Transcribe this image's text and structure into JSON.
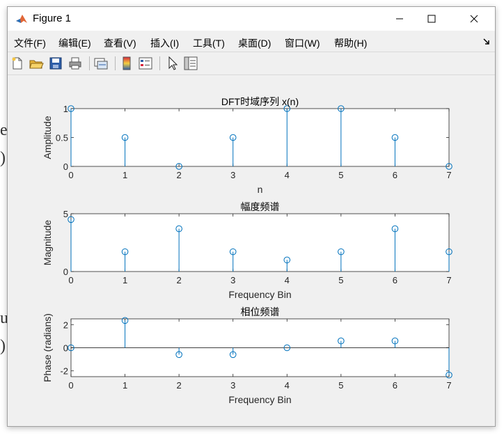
{
  "window": {
    "title": "Figure 1"
  },
  "menubar": {
    "items": [
      "文件(F)",
      "编辑(E)",
      "查看(V)",
      "插入(I)",
      "工具(T)",
      "桌面(D)",
      "窗口(W)",
      "帮助(H)"
    ]
  },
  "toolbar": {
    "buttons": [
      "new-figure-icon",
      "open-file-icon",
      "save-icon",
      "print-icon",
      "link-plot-icon",
      "colorbar-icon",
      "legend-icon",
      "pointer-icon",
      "property-inspector-icon"
    ]
  },
  "background_text": [
    "e",
    ")",
    "u",
    ")"
  ],
  "colors": {
    "stem": "#0072bd",
    "axes": "#262626",
    "figure_bg": "#f0f0f0",
    "axes_bg": "#ffffff"
  },
  "chart_data": [
    {
      "type": "stem",
      "title": "DFT时域序列 x(n)",
      "xlabel": "n",
      "ylabel": "Amplitude",
      "x": [
        0,
        1,
        2,
        3,
        4,
        5,
        6,
        7
      ],
      "values": [
        1,
        0.5,
        0,
        0.5,
        1,
        1,
        0.5,
        0
      ],
      "xlim": [
        0,
        7
      ],
      "ylim": [
        0,
        1
      ],
      "xticks": [
        "0",
        "1",
        "2",
        "3",
        "4",
        "5",
        "6",
        "7"
      ],
      "yticks": [
        0,
        0.5,
        1
      ],
      "ytick_labels": [
        "0",
        "0.5",
        "1"
      ],
      "baseline": 0
    },
    {
      "type": "stem",
      "title": "幅度频谱",
      "xlabel": "Frequency Bin",
      "ylabel": "Magnitude",
      "x": [
        0,
        1,
        2,
        3,
        4,
        5,
        6,
        7
      ],
      "values": [
        4.5,
        1.71,
        3.7,
        1.71,
        1.0,
        1.71,
        3.7,
        1.71
      ],
      "xlim": [
        0,
        7
      ],
      "ylim": [
        0,
        5
      ],
      "xticks": [
        "0",
        "1",
        "2",
        "3",
        "4",
        "5",
        "6",
        "7"
      ],
      "yticks": [
        0,
        5
      ],
      "ytick_labels": [
        "0",
        "5"
      ],
      "baseline": 0
    },
    {
      "type": "stem",
      "title": "相位频谱",
      "xlabel": "Frequency Bin",
      "ylabel": "Phase (radians)",
      "x": [
        0,
        1,
        2,
        3,
        4,
        5,
        6,
        7
      ],
      "values": [
        0,
        2.36,
        -0.59,
        -0.59,
        0,
        0.59,
        0.59,
        -2.36
      ],
      "xlim": [
        0,
        7
      ],
      "ylim": [
        -2.5,
        2.5
      ],
      "xticks": [
        "0",
        "1",
        "2",
        "3",
        "4",
        "5",
        "6",
        "7"
      ],
      "yticks": [
        -2,
        0,
        2
      ],
      "ytick_labels": [
        "-2",
        "0",
        "2"
      ],
      "baseline": 0
    }
  ]
}
